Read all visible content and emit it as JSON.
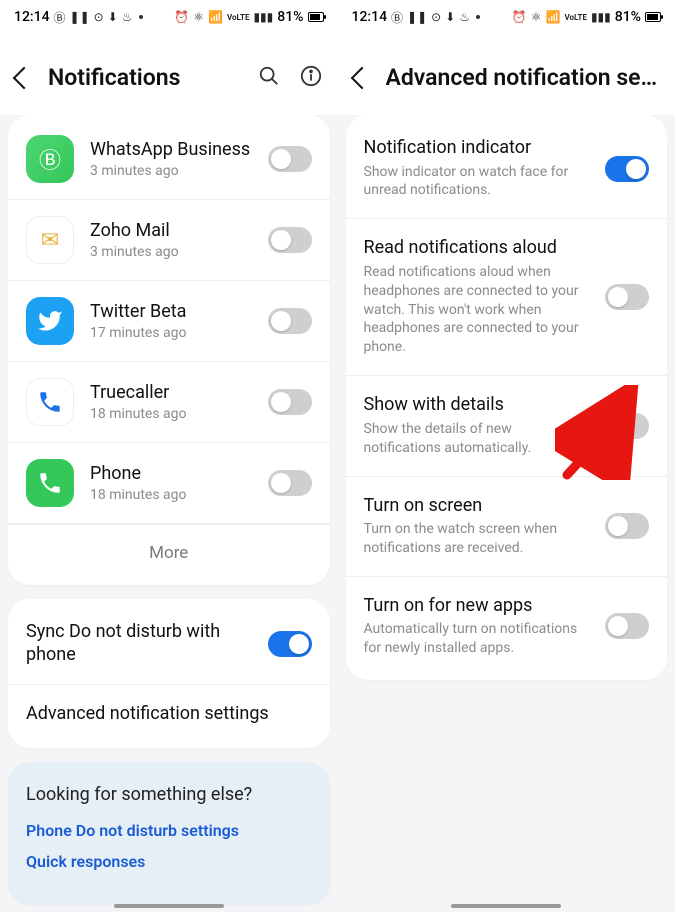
{
  "statusbar": {
    "time": "12:14",
    "battery_pct": "81%"
  },
  "left": {
    "header_title": "Notifications",
    "apps": [
      {
        "name": "WhatsApp Business",
        "time": "3 minutes ago",
        "icon": "whatsapp-business",
        "on": false
      },
      {
        "name": "Zoho Mail",
        "time": "3 minutes ago",
        "icon": "zoho-mail",
        "on": false
      },
      {
        "name": "Twitter Beta",
        "time": "17 minutes ago",
        "icon": "twitter",
        "on": false
      },
      {
        "name": "Truecaller",
        "time": "18 minutes ago",
        "icon": "truecaller",
        "on": false
      },
      {
        "name": "Phone",
        "time": "18 minutes ago",
        "icon": "phone",
        "on": false
      }
    ],
    "more_label": "More",
    "sync": {
      "title": "Sync Do not disturb with phone",
      "on": true
    },
    "advanced_label": "Advanced notification settings",
    "tips": {
      "title": "Looking for something else?",
      "links": [
        "Phone Do not disturb settings",
        "Quick responses"
      ]
    }
  },
  "right": {
    "header_title": "Advanced notification sett…",
    "settings": [
      {
        "title": "Notification indicator",
        "sub": "Show indicator on watch face for unread notifications.",
        "on": true
      },
      {
        "title": "Read notifications aloud",
        "sub": "Read notifications aloud when headphones are connected to your watch. This won't work when headphones are connected to your phone.",
        "on": false
      },
      {
        "title": "Show with details",
        "sub": "Show the details of new notifications automatically.",
        "on": false
      },
      {
        "title": "Turn on screen",
        "sub": "Turn on the watch screen when notifications are received.",
        "on": false
      },
      {
        "title": "Turn on for new apps",
        "sub": "Automatically turn on notifications for newly installed apps.",
        "on": false
      }
    ]
  }
}
